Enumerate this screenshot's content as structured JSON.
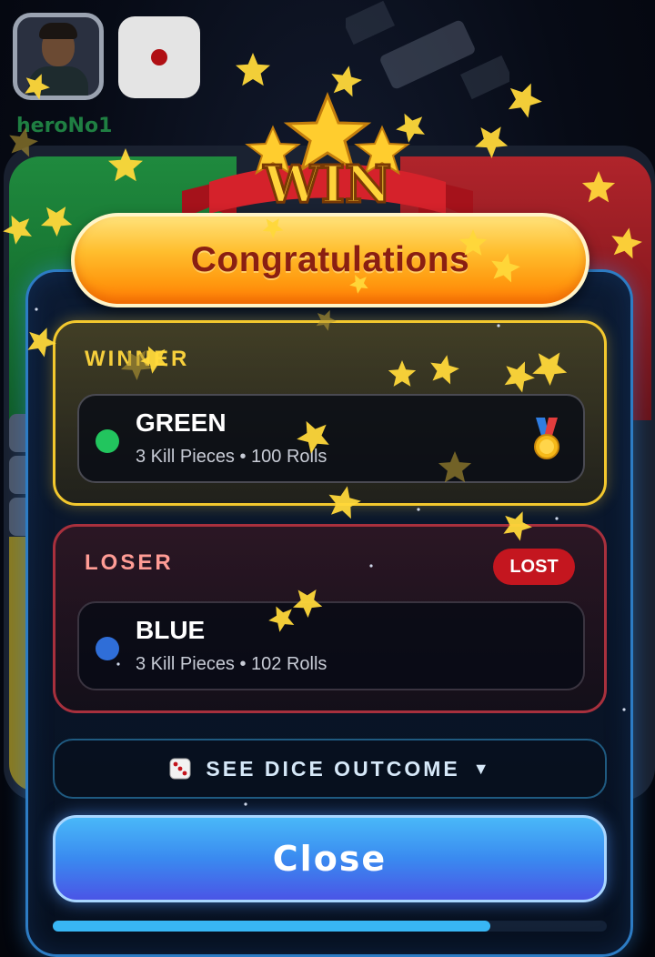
{
  "player": {
    "name": "heroNo1",
    "avatar_icon": "player-avatar-icon",
    "dice_icon": "dice-one-icon"
  },
  "modal": {
    "banner_text": "WIN",
    "title": "Congratulations",
    "winner": {
      "heading": "WINNER",
      "color_name": "GREEN",
      "color_hex": "#22c55e",
      "stats": "3 Kill Pieces • 100 Rolls",
      "medal_icon": "gold-medal-icon"
    },
    "loser": {
      "heading": "LOSER",
      "badge": "LOST",
      "color_name": "BLUE",
      "color_hex": "#2f6ed8",
      "stats": "3 Kill Pieces • 102 Rolls"
    },
    "dice_outcome_label": "SEE DICE OUTCOME",
    "dice_outcome_chevron": "▼",
    "close_label": "Close",
    "timer_progress": 0.79
  },
  "colors": {
    "gold": "#f3c82e",
    "loser_red": "#a8303d",
    "accent_blue": "#38b6f4",
    "orange": "#ff9a10"
  }
}
